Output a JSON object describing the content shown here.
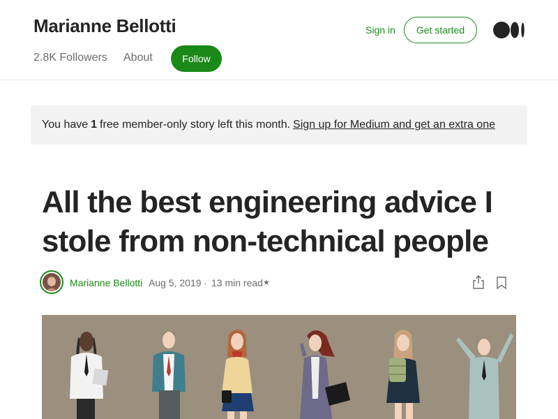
{
  "header": {
    "author_name": "Marianne Bellotti",
    "followers": "2.8K Followers",
    "about": "About",
    "follow": "Follow",
    "sign_in": "Sign in",
    "get_started": "Get started",
    "logo_icon": "medium-logo-icon"
  },
  "banner": {
    "prefix": "You have",
    "count": "1",
    "suffix": "free member-only story left this month.",
    "link": "Sign up for Medium and get an extra one"
  },
  "article": {
    "title": "All the best engineering advice I stole from non-technical people",
    "author": "Marianne Bellotti",
    "date": "Aug 5, 2019",
    "separator": "·",
    "read_time": "13 min read",
    "member_star": "★"
  },
  "icons": {
    "share": "share-icon",
    "bookmark": "bookmark-icon"
  },
  "colors": {
    "accent": "#1a8917",
    "hero_background": "#9b8f7e",
    "banner_background": "#f2f2f2"
  }
}
